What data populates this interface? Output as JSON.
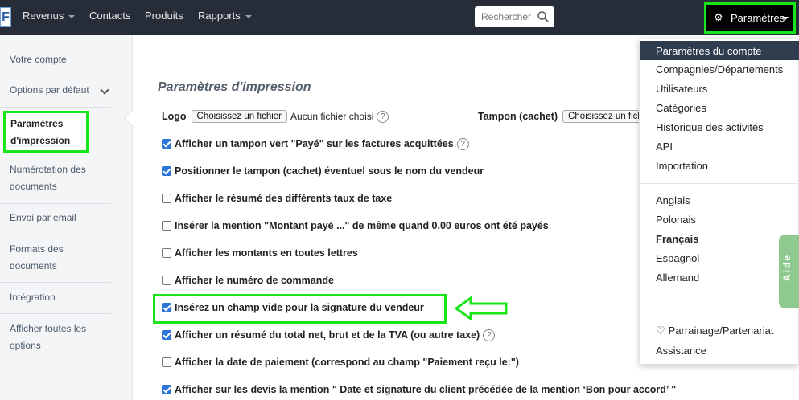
{
  "navbar": {
    "logo": "F",
    "items": [
      {
        "label": "Revenus",
        "caret": true
      },
      {
        "label": "Contacts",
        "caret": false
      },
      {
        "label": "Produits",
        "caret": false
      },
      {
        "label": "Rapports",
        "caret": true
      }
    ],
    "search_placeholder": "Rechercher",
    "settings_label": "Paramètres"
  },
  "sidebar": {
    "items": [
      "Votre compte",
      "Options par défaut",
      "Paramètres d'impression",
      "Numérotation des documents",
      "Envoi par email",
      "Formats des documents",
      "Intégration",
      "Afficher toutes les options"
    ]
  },
  "main": {
    "title": "Paramètres d'impression",
    "logo_label": "Logo",
    "file_button": "Choisissez un fichier",
    "no_file": "Aucun fichier choisi",
    "stamp_label": "Tampon (cachet)",
    "stamp_file_button": "Choisissez un fich",
    "help_glyph": "?",
    "options": [
      {
        "label": "Afficher un tampon vert \"Payé\" sur les factures acquittées",
        "checked": true,
        "help": true
      },
      {
        "label": "Positionner le tampon (cachet) éventuel sous le nom du vendeur",
        "checked": true,
        "help": false
      },
      {
        "label": "Afficher le résumé des différents taux de taxe",
        "checked": false,
        "help": false
      },
      {
        "label": "Insérer la mention \"Montant payé ...\" de même quand 0.00 euros ont été payés",
        "checked": false,
        "help": false
      },
      {
        "label": "Afficher les montants en toutes lettres",
        "checked": false,
        "help": false
      },
      {
        "label": "Afficher le numéro de commande",
        "checked": false,
        "help": false
      },
      {
        "label": "Insérez un champ vide pour la signature du vendeur",
        "checked": true,
        "help": false
      },
      {
        "label": "Afficher un résumé du total net, brut et de la TVA (ou autre taxe)",
        "checked": true,
        "help": true
      },
      {
        "label": "Afficher la date de paiement (correspond au champ \"Paiement reçu le:\")",
        "checked": false,
        "help": false
      },
      {
        "label": "Afficher sur les devis la mention \" Date et signature du client précédée de la mention ‘Bon pour accord’ \"",
        "checked": true,
        "help": false
      }
    ]
  },
  "dropdown": {
    "group1": [
      "Paramètres du compte",
      "Compagnies/Départements",
      "Utilisateurs",
      "Catégories",
      "Historique des activités",
      "API",
      "Importation"
    ],
    "languages": [
      "Anglais",
      "Polonais",
      "Français",
      "Espagnol",
      "Allemand"
    ],
    "referral": "Parrainage/Partenariat",
    "assistance": "Assistance"
  },
  "help_tab": "Aide",
  "colors": {
    "navbar": "#262d38",
    "highlight": "#19e619",
    "checkbox": "#2c76d8",
    "dropdown_active": "#2f3d4e",
    "help_tab": "#8fc98f"
  }
}
